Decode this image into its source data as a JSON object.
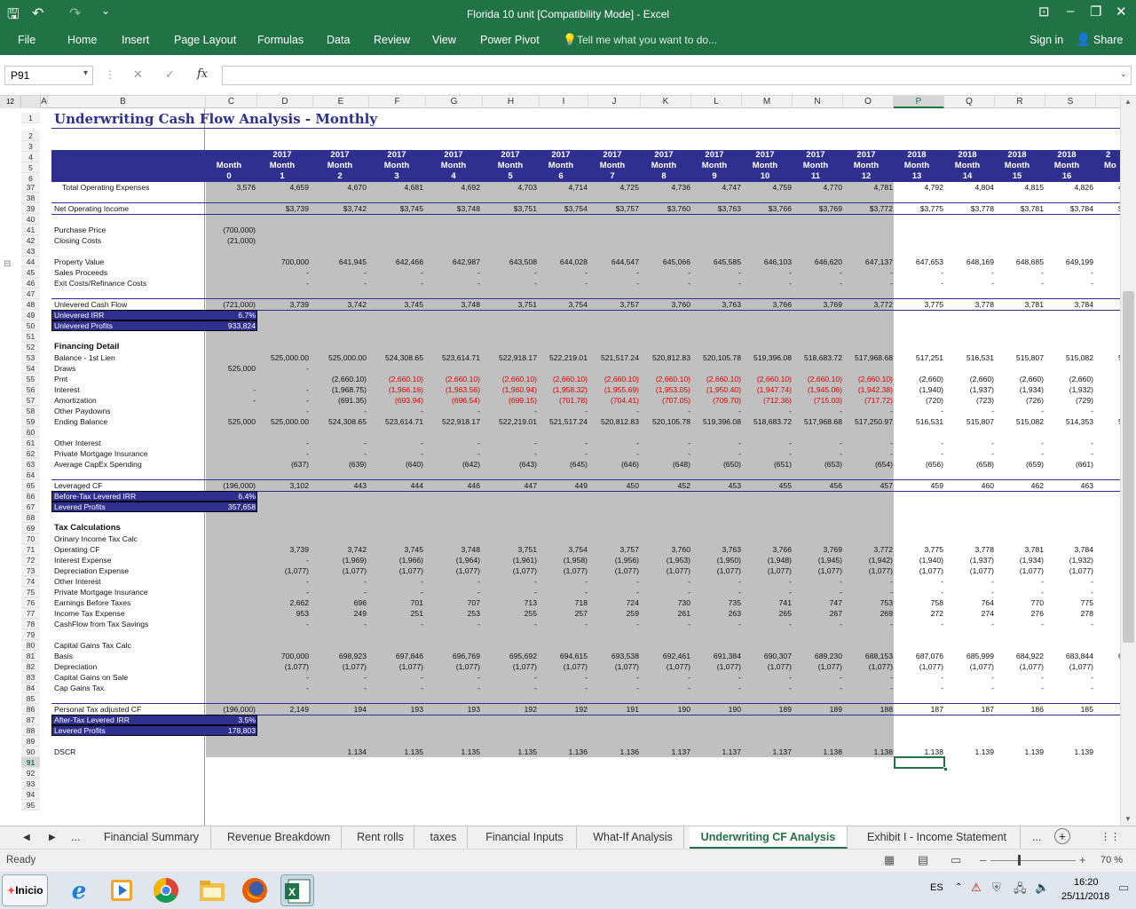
{
  "window": {
    "title": "Florida 10 unit  [Compatibility Mode] - Excel",
    "qat": {
      "save": "🖫",
      "undo": "↶",
      "redo": "↷",
      "more": "⌄"
    },
    "controls": {
      "restore_ribbon": "⊡",
      "minimize": "–",
      "restore": "❐",
      "close": "✕"
    }
  },
  "ribbon": {
    "tabs": [
      "File",
      "Home",
      "Insert",
      "Page Layout",
      "Formulas",
      "Data",
      "Review",
      "View",
      "Power Pivot"
    ],
    "tell_me": "Tell me what you want to do...",
    "sign_in": "Sign in",
    "share": "Share"
  },
  "formula_bar": {
    "name_box": "P91",
    "cancel": "✕",
    "enter": "✓",
    "fx": "fx",
    "value": ""
  },
  "outline_levels": [
    "1",
    "2"
  ],
  "columns": [
    "A",
    "B",
    "C",
    "D",
    "E",
    "F",
    "G",
    "H",
    "I",
    "J",
    "K",
    "L",
    "M",
    "N",
    "O",
    "P",
    "Q",
    "R",
    "S"
  ],
  "sheet_title": "Underwriting Cash Flow Analysis - Monthly",
  "header_years": [
    "",
    "2017",
    "2017",
    "2017",
    "2017",
    "2017",
    "2017",
    "2017",
    "2017",
    "2017",
    "2017",
    "2017",
    "2017",
    "2018",
    "2018",
    "2018",
    "2018"
  ],
  "header_month_label": "Month",
  "header_month_nums": [
    "0",
    "1",
    "2",
    "3",
    "4",
    "5",
    "6",
    "7",
    "8",
    "9",
    "10",
    "11",
    "12",
    "13",
    "14",
    "15",
    "16"
  ],
  "header_overflow": [
    "2",
    "Mo"
  ],
  "rows": [
    {
      "n": "1",
      "label": ""
    },
    {
      "n": "2",
      "label": ""
    },
    {
      "n": "3",
      "label": ""
    },
    {
      "n": "4",
      "label": ""
    },
    {
      "n": "5",
      "label": ""
    },
    {
      "n": "6",
      "label": ""
    },
    {
      "n": "37",
      "label": "Total Operating Expenses",
      "indent": true,
      "vals": [
        "3,576",
        "4,659",
        "4,670",
        "4,681",
        "4,692",
        "4,703",
        "4,714",
        "4,725",
        "4,736",
        "4,747",
        "4,759",
        "4,770",
        "4,781",
        "4,792",
        "4,804",
        "4,815",
        "4,826",
        "4,"
      ]
    },
    {
      "n": "38",
      "label": ""
    },
    {
      "n": "39",
      "label": "Net Operating Income",
      "line": true,
      "vals": [
        "",
        "$3,739",
        "$3,742",
        "$3,745",
        "$3,748",
        "$3,751",
        "$3,754",
        "$3,757",
        "$3,760",
        "$3,763",
        "$3,766",
        "$3,769",
        "$3,772",
        "$3,775",
        "$3,778",
        "$3,781",
        "$3,784",
        "$3,7"
      ]
    },
    {
      "n": "40",
      "label": ""
    },
    {
      "n": "41",
      "label": "Purchase Price",
      "vals": [
        "(700,000)"
      ]
    },
    {
      "n": "42",
      "label": "Closing Costs",
      "vals": [
        "(21,000)"
      ]
    },
    {
      "n": "43",
      "label": ""
    },
    {
      "n": "44",
      "label": "Property Value",
      "vals": [
        "",
        "700,000",
        "641,945",
        "642,466",
        "642,987",
        "643,508",
        "644,028",
        "644,547",
        "645,066",
        "645,585",
        "646,103",
        "646,620",
        "647,137",
        "647,653",
        "648,169",
        "648,685",
        "649,199"
      ]
    },
    {
      "n": "45",
      "label": "Sales Proceeds",
      "vals": [
        "",
        "-",
        "-",
        "-",
        "-",
        "-",
        "-",
        "-",
        "-",
        "-",
        "-",
        "-",
        "-",
        "-",
        "-",
        "-",
        "-"
      ]
    },
    {
      "n": "46",
      "label": "Exit Costs/Refinance Costs",
      "vals": [
        "",
        "-",
        "-",
        "-",
        "-",
        "-",
        "-",
        "-",
        "-",
        "-",
        "-",
        "-",
        "-",
        "-",
        "-",
        "-",
        "-"
      ]
    },
    {
      "n": "47",
      "label": ""
    },
    {
      "n": "48",
      "label": "Unlevered Cash Flow",
      "line": true,
      "vals": [
        "(721,000)",
        "3,739",
        "3,742",
        "3,745",
        "3,748",
        "3,751",
        "3,754",
        "3,757",
        "3,760",
        "3,763",
        "3,766",
        "3,769",
        "3,772",
        "3,775",
        "3,778",
        "3,781",
        "3,784"
      ]
    },
    {
      "n": "49",
      "label": "Unlevered IRR",
      "box": true,
      "vals": [
        "6.7%"
      ]
    },
    {
      "n": "50",
      "label": "Unlevered Profits",
      "box": true,
      "vals": [
        "933,824"
      ]
    },
    {
      "n": "51",
      "label": ""
    },
    {
      "n": "52",
      "label": "Financing Detail",
      "bold": true
    },
    {
      "n": "53",
      "label": "Balance - 1st Lien",
      "vals": [
        "",
        "525,000.00",
        "525,000.00",
        "524,308.65",
        "523,614.71",
        "522,918.17",
        "522,219.01",
        "521,517.24",
        "520,812.83",
        "520,105.78",
        "519,396.08",
        "518,683.72",
        "517,968.68",
        "517,251",
        "516,531",
        "515,807",
        "515,082",
        "5"
      ]
    },
    {
      "n": "54",
      "label": "Draws",
      "vals": [
        "525,000",
        "-"
      ]
    },
    {
      "n": "55",
      "label": "Pmt",
      "vals": [
        "",
        "",
        "(2,660.10)",
        "(2,660.10)",
        "(2,660.10)",
        "(2,660.10)",
        "(2,660.10)",
        "(2,660.10)",
        "(2,660.10)",
        "(2,660.10)",
        "(2,660.10)",
        "(2,660.10)",
        "(2,660.10)",
        "(2,660)",
        "(2,660)",
        "(2,660)",
        "(2,660)"
      ],
      "redfrom": 3
    },
    {
      "n": "56",
      "label": "Interest",
      "vals": [
        "-",
        "-",
        "(1,968.75)",
        "(1,966.16)",
        "(1,963.56)",
        "(1,960.94)",
        "(1,958.32)",
        "(1,955.69)",
        "(1,953.05)",
        "(1,950.40)",
        "(1,947.74)",
        "(1,945.06)",
        "(1,942.38)",
        "(1,940)",
        "(1,937)",
        "(1,934)",
        "(1,932)"
      ],
      "redfrom": 3
    },
    {
      "n": "57",
      "label": "Amortization",
      "vals": [
        "-",
        "-",
        "(691.35)",
        "(693.94)",
        "(696.54)",
        "(699.15)",
        "(701.78)",
        "(704.41)",
        "(707.05)",
        "(709.70)",
        "(712.36)",
        "(715.03)",
        "(717.72)",
        "(720)",
        "(723)",
        "(726)",
        "(729)"
      ],
      "redfrom": 3
    },
    {
      "n": "58",
      "label": "Other Paydowns",
      "vals": [
        "",
        "-",
        "-",
        "-",
        "-",
        "-",
        "-",
        "-",
        "-",
        "-",
        "-",
        "-",
        "-",
        "-",
        "-",
        "-",
        "-"
      ]
    },
    {
      "n": "59",
      "label": "Ending Balance",
      "vals": [
        "525,000",
        "525,000.00",
        "524,308.65",
        "523,614.71",
        "522,918.17",
        "522,219.01",
        "521,517.24",
        "520,812.83",
        "520,105.78",
        "519,396.08",
        "518,683.72",
        "517,968.68",
        "517,250.97",
        "516,531",
        "515,807",
        "515,082",
        "514,353",
        "5"
      ]
    },
    {
      "n": "60",
      "label": ""
    },
    {
      "n": "61",
      "label": "Other Interest",
      "vals": [
        "",
        "-",
        "-",
        "-",
        "-",
        "-",
        "-",
        "-",
        "-",
        "-",
        "-",
        "-",
        "-",
        "-",
        "-",
        "-",
        "-"
      ]
    },
    {
      "n": "62",
      "label": "Private Mortgage Insurance",
      "vals": [
        "",
        "-",
        "-",
        "-",
        "-",
        "-",
        "-",
        "-",
        "-",
        "-",
        "-",
        "-",
        "-",
        "-",
        "-",
        "-",
        "-"
      ]
    },
    {
      "n": "63",
      "label": "Average CapEx Spending",
      "vals": [
        "",
        "(637)",
        "(639)",
        "(640)",
        "(642)",
        "(643)",
        "(645)",
        "(646)",
        "(648)",
        "(650)",
        "(651)",
        "(653)",
        "(654)",
        "(656)",
        "(658)",
        "(659)",
        "(661)"
      ]
    },
    {
      "n": "64",
      "label": ""
    },
    {
      "n": "65",
      "label": "Leveraged CF",
      "line": true,
      "vals": [
        "(196,000)",
        "3,102",
        "443",
        "444",
        "446",
        "447",
        "449",
        "450",
        "452",
        "453",
        "455",
        "456",
        "457",
        "459",
        "460",
        "462",
        "463"
      ]
    },
    {
      "n": "66",
      "label": "Before-Tax Levered IRR",
      "box": true,
      "vals": [
        "6.4%"
      ]
    },
    {
      "n": "67",
      "label": "Levered Profits",
      "box": true,
      "vals": [
        "357,658"
      ]
    },
    {
      "n": "68",
      "label": ""
    },
    {
      "n": "69",
      "label": "Tax Calculations",
      "bold": true
    },
    {
      "n": "70",
      "label": "Orinary Income Tax Calc"
    },
    {
      "n": "71",
      "label": "Operating CF",
      "vals": [
        "",
        "3,739",
        "3,742",
        "3,745",
        "3,748",
        "3,751",
        "3,754",
        "3,757",
        "3,760",
        "3,763",
        "3,766",
        "3,769",
        "3,772",
        "3,775",
        "3,778",
        "3,781",
        "3,784"
      ]
    },
    {
      "n": "72",
      "label": "Interest Expense",
      "vals": [
        "",
        "-",
        "(1,969)",
        "(1,966)",
        "(1,964)",
        "(1,961)",
        "(1,958)",
        "(1,956)",
        "(1,953)",
        "(1,950)",
        "(1,948)",
        "(1,945)",
        "(1,942)",
        "(1,940)",
        "(1,937)",
        "(1,934)",
        "(1,932)"
      ]
    },
    {
      "n": "73",
      "label": "Depreciation Expense",
      "vals": [
        "",
        "(1,077)",
        "(1,077)",
        "(1,077)",
        "(1,077)",
        "(1,077)",
        "(1,077)",
        "(1,077)",
        "(1,077)",
        "(1,077)",
        "(1,077)",
        "(1,077)",
        "(1,077)",
        "(1,077)",
        "(1,077)",
        "(1,077)",
        "(1,077)"
      ]
    },
    {
      "n": "74",
      "label": "Other Interest",
      "vals": [
        "",
        "-",
        "-",
        "-",
        "-",
        "-",
        "-",
        "-",
        "-",
        "-",
        "-",
        "-",
        "-",
        "-",
        "-",
        "-",
        "-"
      ]
    },
    {
      "n": "75",
      "label": "Private Mortgage Insurance",
      "vals": [
        "",
        "-",
        "-",
        "-",
        "-",
        "-",
        "-",
        "-",
        "-",
        "-",
        "-",
        "-",
        "-",
        "-",
        "-",
        "-",
        "-"
      ]
    },
    {
      "n": "76",
      "label": "Earnings Before Taxes",
      "vals": [
        "",
        "2,662",
        "696",
        "701",
        "707",
        "713",
        "718",
        "724",
        "730",
        "735",
        "741",
        "747",
        "753",
        "758",
        "764",
        "770",
        "775"
      ]
    },
    {
      "n": "77",
      "label": "Income Tax Expense",
      "vals": [
        "",
        "953",
        "249",
        "251",
        "253",
        "255",
        "257",
        "259",
        "261",
        "263",
        "265",
        "267",
        "269",
        "272",
        "274",
        "276",
        "278"
      ]
    },
    {
      "n": "78",
      "label": "CashFlow from Tax Savings",
      "vals": [
        "",
        "-",
        "-",
        "-",
        "-",
        "-",
        "-",
        "-",
        "-",
        "-",
        "-",
        "-",
        "-",
        "-",
        "-",
        "-",
        "-"
      ]
    },
    {
      "n": "79",
      "label": ""
    },
    {
      "n": "80",
      "label": "Capital Gains Tax Calc"
    },
    {
      "n": "81",
      "label": "Basis",
      "vals": [
        "",
        "700,000",
        "698,923",
        "697,846",
        "696,769",
        "695,692",
        "694,615",
        "693,538",
        "692,461",
        "691,384",
        "690,307",
        "689,230",
        "688,153",
        "687,076",
        "685,999",
        "684,922",
        "683,844",
        "6"
      ]
    },
    {
      "n": "82",
      "label": "Depreciation",
      "vals": [
        "",
        "(1,077)",
        "(1,077)",
        "(1,077)",
        "(1,077)",
        "(1,077)",
        "(1,077)",
        "(1,077)",
        "(1,077)",
        "(1,077)",
        "(1,077)",
        "(1,077)",
        "(1,077)",
        "(1,077)",
        "(1,077)",
        "(1,077)",
        "(1,077)"
      ]
    },
    {
      "n": "83",
      "label": "Capital Gains on Sale",
      "vals": [
        "",
        "-",
        "-",
        "-",
        "-",
        "-",
        "-",
        "-",
        "-",
        "-",
        "-",
        "-",
        "-",
        "-",
        "-",
        "-",
        "-"
      ]
    },
    {
      "n": "84",
      "label": "Cap Gains Tax",
      "vals": [
        "",
        "-",
        "-",
        "-",
        "-",
        "-",
        "-",
        "-",
        "-",
        "-",
        "-",
        "-",
        "-",
        "-",
        "-",
        "-",
        "-"
      ]
    },
    {
      "n": "85",
      "label": ""
    },
    {
      "n": "86",
      "label": "Personal Tax adjusted CF",
      "line": true,
      "vals": [
        "(196,000)",
        "2,149",
        "194",
        "193",
        "193",
        "192",
        "192",
        "191",
        "190",
        "190",
        "189",
        "189",
        "188",
        "187",
        "187",
        "186",
        "185"
      ]
    },
    {
      "n": "87",
      "label": "After-Tax Levered IRR",
      "box": true,
      "vals": [
        "3.5%"
      ]
    },
    {
      "n": "88",
      "label": "Levered Profits",
      "box": true,
      "vals": [
        "178,803"
      ]
    },
    {
      "n": "89",
      "label": ""
    },
    {
      "n": "90",
      "label": "DSCR",
      "vals": [
        "",
        "",
        "1.134",
        "1.135",
        "1.135",
        "1.135",
        "1.136",
        "1.136",
        "1.137",
        "1.137",
        "1.137",
        "1.138",
        "1.138",
        "1.138",
        "1.139",
        "1.139",
        "1.139"
      ]
    },
    {
      "n": "91",
      "label": ""
    },
    {
      "n": "92",
      "label": ""
    },
    {
      "n": "93",
      "label": ""
    },
    {
      "n": "94",
      "label": ""
    },
    {
      "n": "95",
      "label": ""
    }
  ],
  "sheet_tabs": {
    "nav": [
      "◀",
      "▶",
      "..."
    ],
    "tabs": [
      "Financial Summary",
      "Revenue Breakdown",
      "Rent rolls",
      "taxes",
      "Financial Inputs",
      "What-If Analysis",
      "Underwriting CF Analysis",
      "Exhibit I - Income Statement"
    ],
    "active": "Underwriting CF Analysis",
    "more": "...",
    "add": "+"
  },
  "status": {
    "ready": "Ready",
    "zoom": "70 %",
    "zoom_minus": "–",
    "zoom_plus": "+"
  },
  "taskbar": {
    "start": "Inicio",
    "lang": "ES",
    "time": "16:20",
    "date": "25/11/2018"
  },
  "colors": {
    "excel_green": "#217346",
    "header_navy": "#2e2f8f",
    "grey_fill": "#c0c0c0",
    "negative": "#e00000"
  }
}
